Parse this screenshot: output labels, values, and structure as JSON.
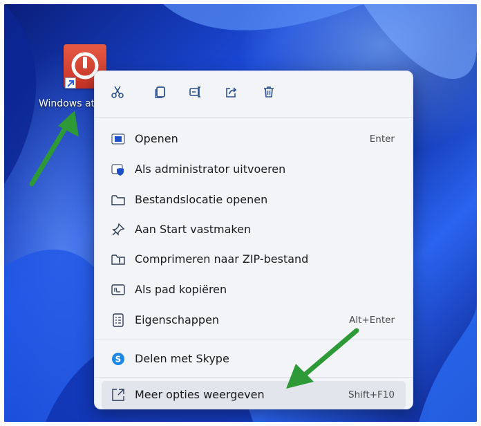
{
  "desktop": {
    "shortcut_label": "Windows at"
  },
  "context_menu": {
    "quick_actions": [
      {
        "name": "cut",
        "icon": "scissors-icon"
      },
      {
        "name": "copy",
        "icon": "copy-icon"
      },
      {
        "name": "rename",
        "icon": "rename-icon"
      },
      {
        "name": "share",
        "icon": "share-icon"
      },
      {
        "name": "delete",
        "icon": "trash-icon"
      }
    ],
    "items": [
      {
        "label": "Openen",
        "shortcut": "Enter",
        "icon": "open-window-icon"
      },
      {
        "label": "Als administrator uitvoeren",
        "shortcut": "",
        "icon": "shield-icon"
      },
      {
        "label": "Bestandslocatie openen",
        "shortcut": "",
        "icon": "folder-icon"
      },
      {
        "label": "Aan Start vastmaken",
        "shortcut": "",
        "icon": "pin-icon"
      },
      {
        "label": "Comprimeren naar ZIP-bestand",
        "shortcut": "",
        "icon": "zip-folder-icon"
      },
      {
        "label": "Als pad kopiëren",
        "shortcut": "",
        "icon": "path-icon"
      },
      {
        "label": "Eigenschappen",
        "shortcut": "Alt+Enter",
        "icon": "properties-icon"
      }
    ],
    "share_item": {
      "label": "Delen met Skype",
      "icon": "skype-icon"
    },
    "more_options": {
      "label": "Meer opties weergeven",
      "shortcut": "Shift+F10",
      "icon": "more-options-icon"
    }
  },
  "colors": {
    "accent_blue": "#1a49d8",
    "menu_background": "#f2f4f8",
    "arrow_green": "#2e9a37",
    "tile_red": "#d43d2c"
  }
}
